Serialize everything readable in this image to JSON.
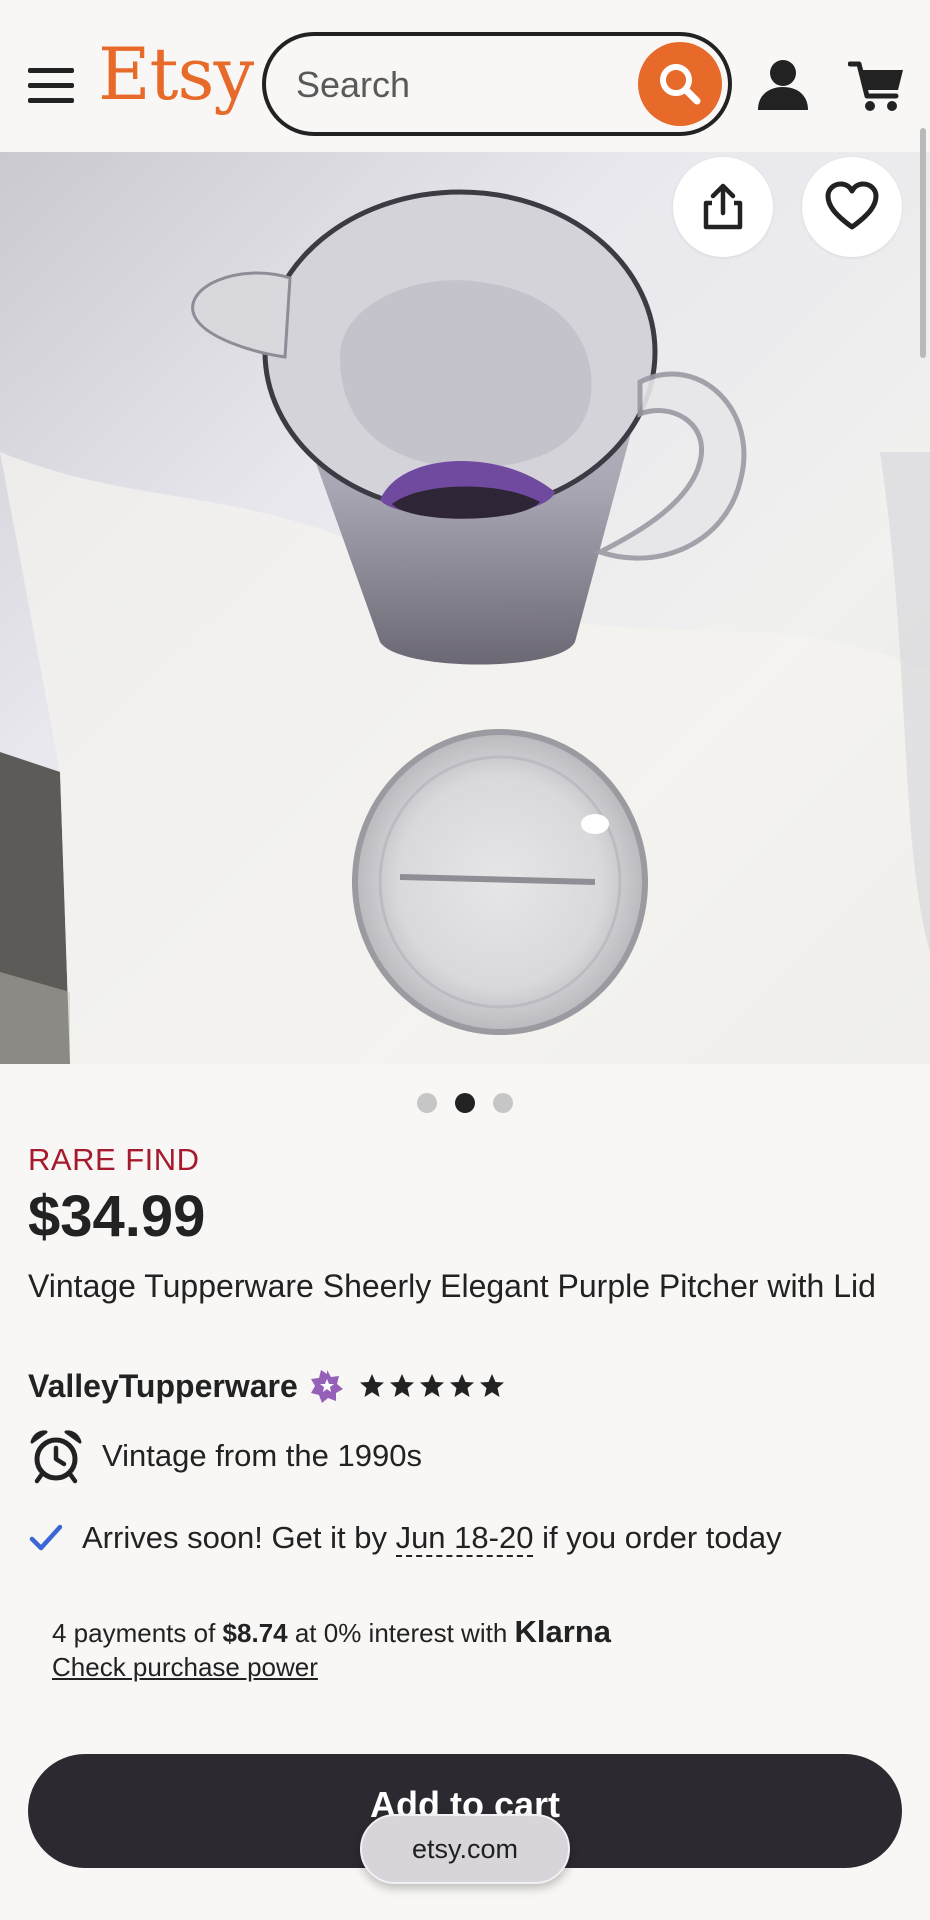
{
  "header": {
    "logo": "Etsy",
    "search_placeholder": "Search",
    "icons": [
      "menu-icon",
      "search-icon",
      "account-icon",
      "cart-icon"
    ]
  },
  "gallery": {
    "share_icon": "share-icon",
    "favorite_icon": "heart-icon",
    "slide_count": 3,
    "active_slide": 2
  },
  "product": {
    "badge": "RARE FIND",
    "price": "$34.99",
    "title": "Vintage Tupperware Sheerly Elegant Purple Pitcher with Lid",
    "seller": "ValleyTupperware",
    "rating_stars": 5,
    "vintage": "Vintage from the 1990s",
    "arrives_prefix": "Arrives soon! Get it by ",
    "arrives_date": "Jun 18-20",
    "arrives_suffix": " if you order today"
  },
  "klarna": {
    "prefix": "4 payments of ",
    "amount": "$8.74",
    "middle": " at 0% interest with ",
    "brand": "Klarna",
    "link": "Check purchase power"
  },
  "cta": {
    "add_to_cart": "Add to cart"
  },
  "browser": {
    "domain": "etsy.com"
  },
  "colors": {
    "brand_orange": "#e86a2b",
    "rare_red": "#a61a2e",
    "button_dark": "#2d2930",
    "star_seller_purple": "#9560b8",
    "check_blue": "#3b67d6"
  }
}
